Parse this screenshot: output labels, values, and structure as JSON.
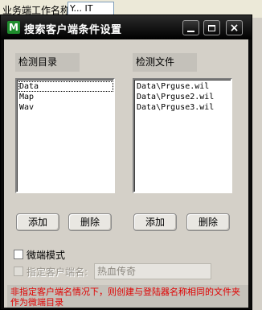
{
  "background": {
    "label": "业务端工作名称:",
    "input_value": "Y... IT"
  },
  "window": {
    "title": "搜索客户端条件设置",
    "app_icon_letter": "M"
  },
  "titlebar": {
    "minimize": "minimize",
    "maximize": "maximize",
    "close": "×"
  },
  "groups": {
    "dirs_label": "检测目录",
    "files_label": "检测文件"
  },
  "dirs": [
    "Data",
    "Map",
    "Wav"
  ],
  "files": [
    "Data\\Prguse.wil",
    "Data\\Prguse2.wil",
    "Data\\Prguse3.wil"
  ],
  "buttons": {
    "add_dir": "添加",
    "del_dir": "删除",
    "add_file": "添加",
    "del_file": "删除"
  },
  "options": {
    "micro_mode_label": "微端模式",
    "micro_mode_checked": false,
    "client_name_label": "指定客户端名:",
    "client_name_checked": false,
    "client_name_value": "热血传奇"
  },
  "notice": "非指定客户端名情况下，则创建与登陆器名称相同的文件夹作为微端目录",
  "colors": {
    "titlebar": "#000000",
    "dialog_bg": "#d4d0c8",
    "notice_text": "#e00000"
  }
}
